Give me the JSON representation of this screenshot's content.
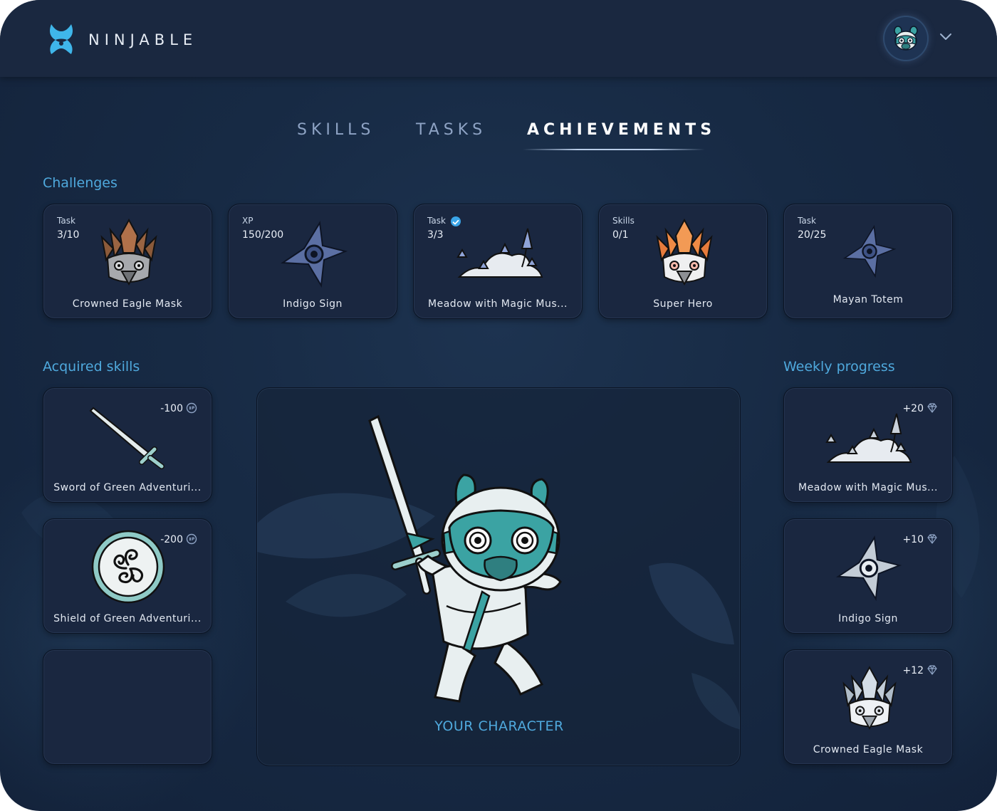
{
  "brand": {
    "name": "NINJABLE"
  },
  "tabs": [
    {
      "label": "SKILLS",
      "active": false
    },
    {
      "label": "TASKS",
      "active": false
    },
    {
      "label": "ACHIEVEMENTS",
      "active": true
    }
  ],
  "challenges": {
    "title": "Challenges",
    "items": [
      {
        "kind": "Task",
        "count": "3/10",
        "name": "Crowned Eagle Mask",
        "icon": "eagle-mask-bronze-icon",
        "verified": false
      },
      {
        "kind": "XP",
        "count": "150/200",
        "name": "Indigo Sign",
        "icon": "indigo-shuriken-icon",
        "verified": false
      },
      {
        "kind": "Task",
        "count": "3/3",
        "name": "Meadow with Magic Mus...",
        "icon": "meadow-mushrooms-icon",
        "verified": true
      },
      {
        "kind": "Skills",
        "count": "0/1",
        "name": "Super Hero",
        "icon": "eagle-mask-orange-icon",
        "verified": false
      },
      {
        "kind": "Task",
        "count": "20/25",
        "name": "Mayan Totem",
        "icon": "indigo-shuriken-small-icon",
        "verified": false
      }
    ]
  },
  "acquired_skills": {
    "title": "Acquired skills",
    "items": [
      {
        "cost": "-100",
        "name": "Sword of Green Adventuri...",
        "icon": "sword-icon"
      },
      {
        "cost": "-200",
        "name": "Shield of Green Adventuri...",
        "icon": "triskelion-shield-icon"
      }
    ]
  },
  "character": {
    "label": "YOUR CHARACTER"
  },
  "weekly_progress": {
    "title": "Weekly progress",
    "items": [
      {
        "reward": "+20",
        "name": "Meadow with Magic Mus...",
        "icon": "meadow-mushrooms-icon"
      },
      {
        "reward": "+10",
        "name": "Indigo Sign",
        "icon": "silver-shuriken-icon"
      },
      {
        "reward": "+12",
        "name": "Crowned Eagle Mask",
        "icon": "eagle-mask-silver-icon"
      }
    ]
  },
  "colors": {
    "accent": "#4fa9dd",
    "background": "#172a44",
    "card": "#1a2740",
    "header": "#1a2840"
  }
}
